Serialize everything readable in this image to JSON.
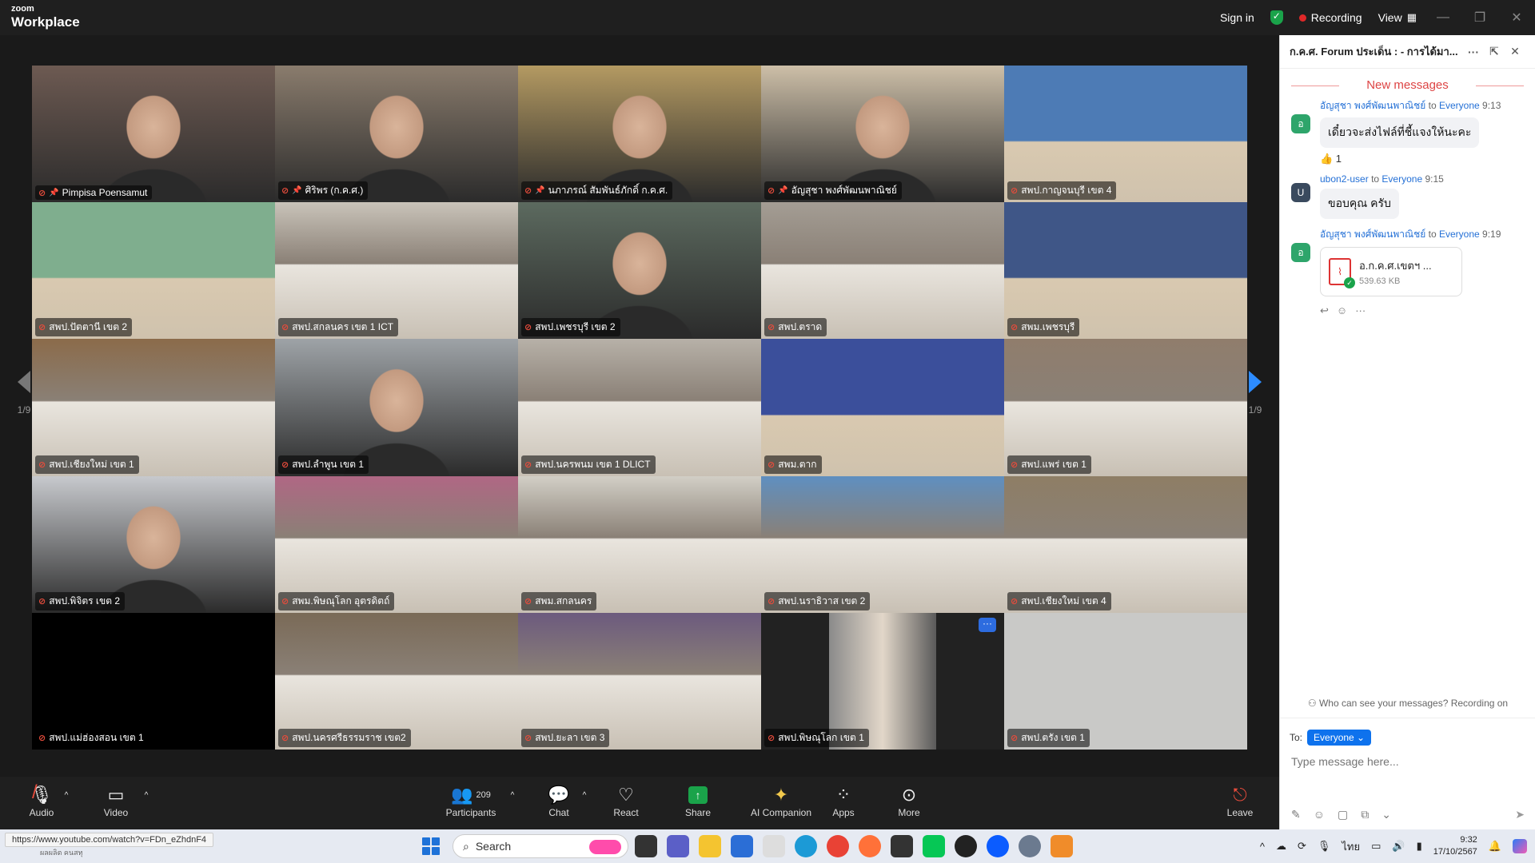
{
  "app": {
    "logo_top": "zoom",
    "logo_bottom": "Workplace"
  },
  "titlebar": {
    "sign_in": "Sign in",
    "recording": "Recording",
    "view": "View"
  },
  "pager": {
    "left": "1/9",
    "right": "1/9"
  },
  "tiles": [
    {
      "label": "Pimpisa Poensamut",
      "bg": "#6d5a52",
      "scene": "person",
      "pinned": true
    },
    {
      "label": "ศิริพร (ก.ค.ศ.)",
      "bg": "#8a7c6d",
      "scene": "person",
      "pinned": true
    },
    {
      "label": "นภาภรณ์ สัมพันธ์ภักดิ์ ก.ค.ศ.",
      "bg": "#b49a62",
      "scene": "person",
      "pinned": true
    },
    {
      "label": "อัญสุชา พงศ์พัฒนพาณิชย์",
      "bg": "#cdbfa8",
      "scene": "person",
      "pinned": true,
      "active": true
    },
    {
      "label": "สพป.กาญจนบุรี เขต 4",
      "bg": "#4d7bb5",
      "scene": "banner"
    },
    {
      "label": "สพป.ปัตตานี เขต 2",
      "bg": "#7fae8e",
      "scene": "banner"
    },
    {
      "label": "สพป.สกลนคร เขต 1 ICT",
      "bg": "#c9c3b9",
      "scene": "room"
    },
    {
      "label": "สพป.เพชรบุรี เขต 2",
      "bg": "#5c6a5f",
      "scene": "person"
    },
    {
      "label": "สพป.ตราด",
      "bg": "#a49d94",
      "scene": "room"
    },
    {
      "label": "สพม.เพชรบุรี",
      "bg": "#3f5687",
      "scene": "banner"
    },
    {
      "label": "สพป.เชียงใหม่ เขต 1",
      "bg": "#8b6b4a",
      "scene": "room"
    },
    {
      "label": "สพป.ลำพูน เขต 1",
      "bg": "#9ea3a7",
      "scene": "person"
    },
    {
      "label": "สพป.นครพนม เขต 1 DLICT",
      "bg": "#b7b1a8",
      "scene": "room"
    },
    {
      "label": "สพม.ตาก",
      "bg": "#3b4f9b",
      "scene": "banner"
    },
    {
      "label": "สพป.แพร่ เขต 1",
      "bg": "#907d6c",
      "scene": "room"
    },
    {
      "label": "สพป.พิจิตร เขต 2",
      "bg": "#c7c9cd",
      "scene": "person"
    },
    {
      "label": "สพม.พิษณุโลก อุตรดิตถ์",
      "bg": "#b06784",
      "scene": "room"
    },
    {
      "label": "สพม.สกลนคร",
      "bg": "#d2cfc6",
      "scene": "room"
    },
    {
      "label": "สพป.นราธิวาส เขต 2",
      "bg": "#5f8fc0",
      "scene": "room"
    },
    {
      "label": "สพป.เชียงใหม่ เขต 4",
      "bg": "#8e7e65",
      "scene": "room"
    },
    {
      "label": "สพป.แม่ฮ่องสอน เขต 1",
      "bg": "#000000",
      "scene": "blank"
    },
    {
      "label": "สพป.นครศรีธรรมราช เขต2",
      "bg": "#7a6a57",
      "scene": "room"
    },
    {
      "label": "สพป.ยะลา เขต 3",
      "bg": "#6c5a7e",
      "scene": "room"
    },
    {
      "label": "สพป.พิษณุโลก เขต 1",
      "bg": "#222222",
      "scene": "portrait",
      "more": "···"
    },
    {
      "label": "สพป.ตรัง เขต 1",
      "bg": "#c9c9c7",
      "scene": "blank"
    }
  ],
  "toolbar": {
    "audio": "Audio",
    "video": "Video",
    "participants": "Participants",
    "participants_count": "209",
    "chat": "Chat",
    "react": "React",
    "share": "Share",
    "ai": "AI Companion",
    "apps": "Apps",
    "more": "More",
    "leave": "Leave"
  },
  "chat": {
    "title": "ก.ค.ศ. Forum ประเด็น : - การได้มา...",
    "new_messages": "New messages",
    "messages": [
      {
        "sender": "อัญสุชา พงศ์พัฒนพาณิชย์",
        "to": "to",
        "recipient": "Everyone",
        "time": "9:13",
        "avatar": "อ",
        "avatar_color": "#2ea56b",
        "text": "เดี๋ยวจะส่งไฟล์ที่ชี้แจงให้นะคะ",
        "reaction": "👍 1"
      },
      {
        "sender": "ubon2-user",
        "to": "to",
        "recipient": "Everyone",
        "time": "9:15",
        "avatar": "U",
        "avatar_color": "#3a4a5e",
        "text": "ขอบคุณ ครับ"
      },
      {
        "sender": "อัญสุชา พงศ์พัฒนพาณิชย์",
        "to": "to",
        "recipient": "Everyone",
        "time": "9:19",
        "avatar": "อ",
        "avatar_color": "#2ea56b",
        "file_name": "อ.ก.ค.ศ.เขตฯ ...",
        "file_size": "539.63 KB"
      }
    ],
    "who_can_see": "Who can see your messages? Recording on",
    "to_label": "To:",
    "to_value": "Everyone",
    "placeholder": "Type message here..."
  },
  "taskbar": {
    "status_url": "https://www.youtube.com/watch?v=FDn_eZhdnF4",
    "status_sub": "ผลผลิต คนสทุ",
    "search": "Search",
    "time": "9:32",
    "date": "17/10/2567",
    "lang": "ไทย"
  }
}
